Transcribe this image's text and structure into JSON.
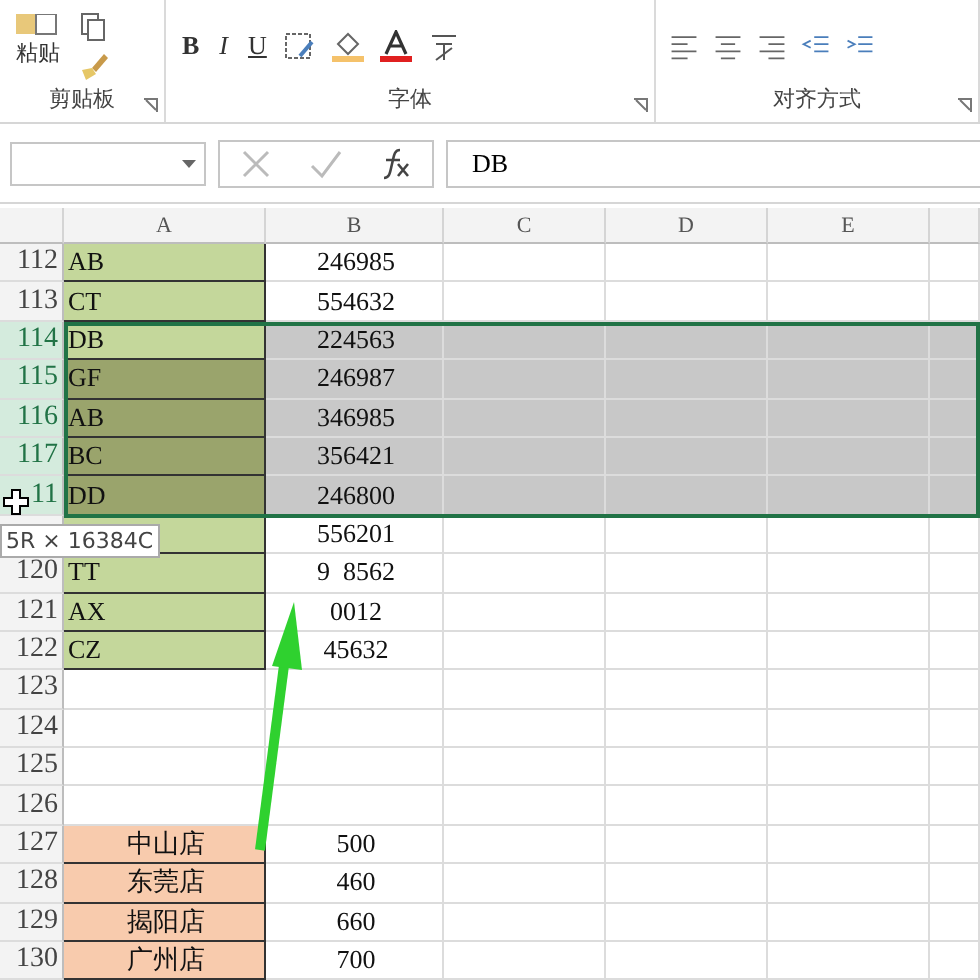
{
  "ribbon": {
    "groups": [
      {
        "label": "剪贴板",
        "kind": "clipboard",
        "button": "粘贴"
      },
      {
        "label": "字体",
        "kind": "font",
        "buttons": [
          "B",
          "I",
          "U"
        ]
      },
      {
        "label": "对齐方式",
        "kind": "align"
      }
    ]
  },
  "formula_bar": {
    "formula": "DB"
  },
  "columns": [
    "A",
    "B",
    "C",
    "D",
    "E"
  ],
  "rows": [
    {
      "number": "112",
      "a": "AB",
      "b": "246985",
      "kind": "green",
      "selected": false
    },
    {
      "number": "113",
      "a": "CT",
      "b": "554632",
      "kind": "green",
      "selected": false
    },
    {
      "number": "114",
      "a": "DB",
      "b": "224563",
      "kind": "green",
      "selected": true,
      "active": true
    },
    {
      "number": "115",
      "a": "GF",
      "b": "246987",
      "kind": "green",
      "selected": true
    },
    {
      "number": "116",
      "a": "AB",
      "b": "346985",
      "kind": "green",
      "selected": true
    },
    {
      "number": "117",
      "a": "BC",
      "b": "356421",
      "kind": "green",
      "selected": true
    },
    {
      "number": "11",
      "a": "DD",
      "b": "246800",
      "kind": "green",
      "selected": true
    },
    {
      "number": "",
      "a": "",
      "b": "556201",
      "kind": "green",
      "selected": false
    },
    {
      "number": "120",
      "a": "TT",
      "b": "9  8562",
      "kind": "green",
      "selected": false
    },
    {
      "number": "121",
      "a": "AX",
      "b": "0012",
      "kind": "green",
      "selected": false
    },
    {
      "number": "122",
      "a": "CZ",
      "b": "45632",
      "kind": "green",
      "selected": false
    },
    {
      "number": "123",
      "a": "",
      "b": "",
      "kind": "plain",
      "selected": false
    },
    {
      "number": "124",
      "a": "",
      "b": "",
      "kind": "plain",
      "selected": false
    },
    {
      "number": "125",
      "a": "",
      "b": "",
      "kind": "plain",
      "selected": false
    },
    {
      "number": "126",
      "a": "",
      "b": "",
      "kind": "plain",
      "selected": false
    },
    {
      "number": "127",
      "a": "中山店",
      "b": "500",
      "kind": "orange",
      "selected": false
    },
    {
      "number": "128",
      "a": "东莞店",
      "b": "460",
      "kind": "orange",
      "selected": false
    },
    {
      "number": "129",
      "a": "揭阳店",
      "b": "660",
      "kind": "orange",
      "selected": false
    },
    {
      "number": "130",
      "a": "广州店",
      "b": "700",
      "kind": "orange",
      "selected": false
    }
  ],
  "tooltip": "5R × 16384C"
}
